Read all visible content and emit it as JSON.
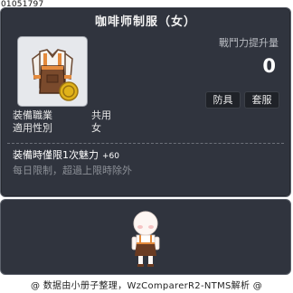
{
  "item_id": "01051797",
  "item_name": "咖啡师制服（女）",
  "combat_power": {
    "label": "戰鬥力提升量",
    "value": "0"
  },
  "tags": [
    "防具",
    "套服"
  ],
  "attributes": [
    {
      "key": "装備職業",
      "value": "共用"
    },
    {
      "key": "適用性別",
      "value": "女"
    }
  ],
  "limit": {
    "text": "装備時僅限1次魅力",
    "bonus": "+60",
    "note": "每日限制，超過上限時除外"
  },
  "footer": "@ 数据由小册子整理，WzComparerR2-NTMS解析 @",
  "icons": {
    "item": "barista-uniform-icon",
    "character": "character-avatar"
  },
  "colors": {
    "panel_bg": "#30343e",
    "panel_border": "#5d626c",
    "coin": "#e0b21a"
  }
}
